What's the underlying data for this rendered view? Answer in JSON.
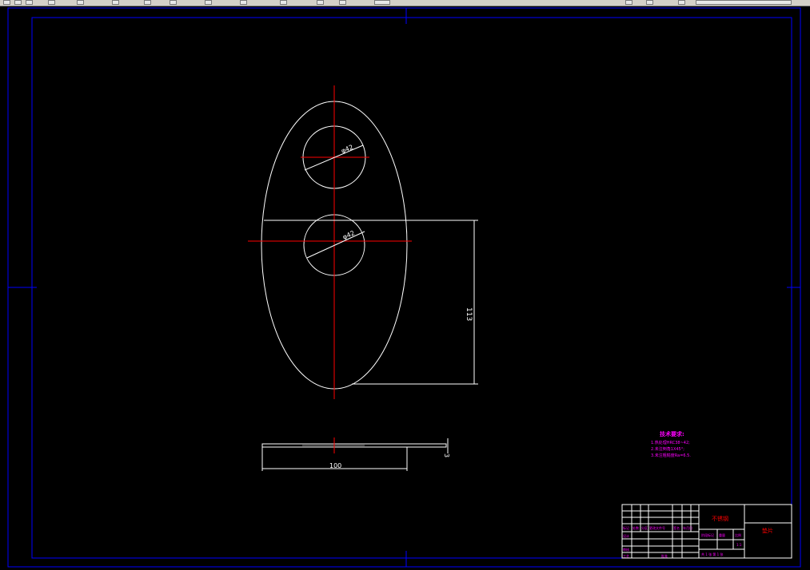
{
  "toolbar": {
    "icons": [
      "new-icon",
      "open-icon",
      "save-icon",
      "print-icon",
      "cut-icon",
      "copy-icon",
      "paste-icon",
      "undo-icon",
      "redo-icon",
      "pan-icon",
      "zoom-icon",
      "properties-icon",
      "layer-icon",
      "help-icon"
    ]
  },
  "drawing": {
    "dimensions": {
      "upper_hole_diameter": "φ42",
      "lower_hole_diameter": "φ42",
      "vertical_length": "113",
      "width": "100",
      "thickness": "3"
    },
    "technical_requirements": {
      "title": "技术要求:",
      "items": [
        "1.热处理HRC38~42;",
        "2.未注倒角1X45°;",
        "3.未注粗糙度Ra=6.5."
      ]
    },
    "title_block": {
      "material": "不锈钢",
      "part_name": "垫片",
      "row_labels": [
        "标记",
        "处数",
        "分区",
        "更改文件号",
        "签名",
        "年月日"
      ],
      "designer_label": "设计",
      "check_label": "审核",
      "process_label": "工艺",
      "approve_label": "批准",
      "stage_label": "阶段标记",
      "weight_label": "重量",
      "scale_label": "比例",
      "scale_value": "1:1",
      "sheets": "共 1 张 第 1 张"
    }
  },
  "colors": {
    "background": "#000000",
    "frame": "#0000ff",
    "geometry": "#ffffff",
    "centerline": "#ff0000",
    "annotation": "#ff00ff",
    "toolbar": "#d4d0c8"
  }
}
